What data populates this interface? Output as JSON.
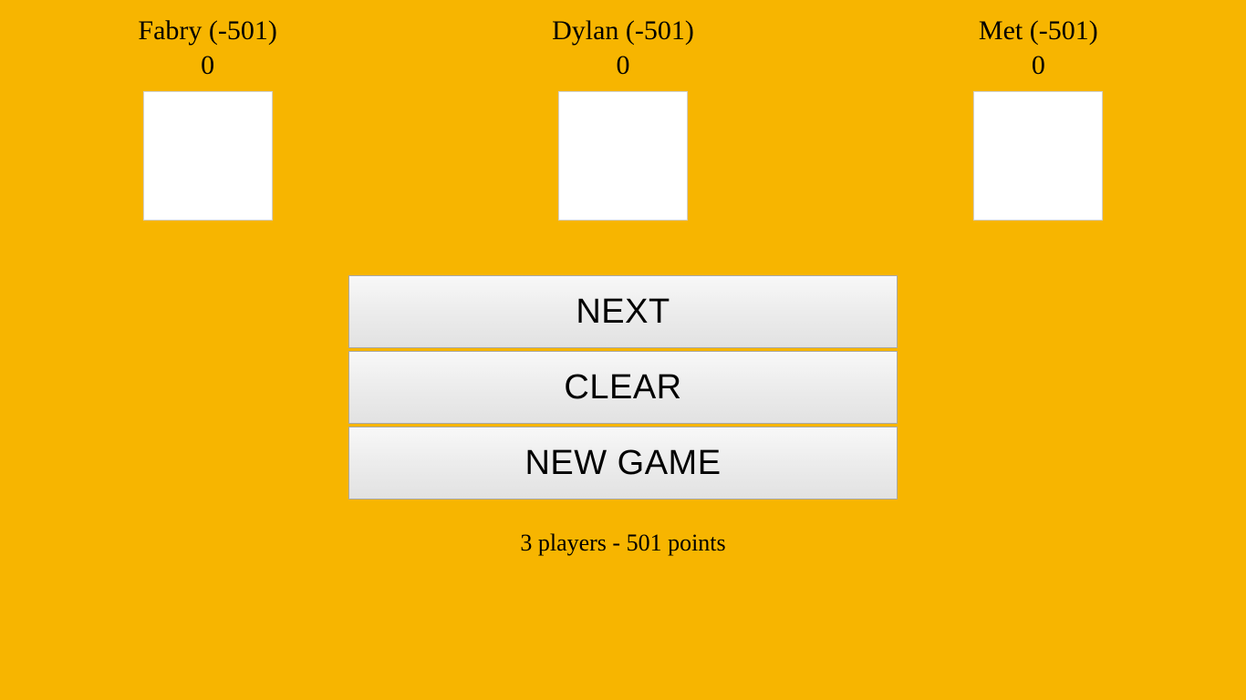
{
  "players": [
    {
      "header": "Fabry (-501)",
      "score": "0"
    },
    {
      "header": "Dylan (-501)",
      "score": "0"
    },
    {
      "header": "Met (-501)",
      "score": "0"
    }
  ],
  "buttons": {
    "next": "NEXT",
    "clear": "CLEAR",
    "new_game": "NEW GAME"
  },
  "status": "3 players - 501 points"
}
